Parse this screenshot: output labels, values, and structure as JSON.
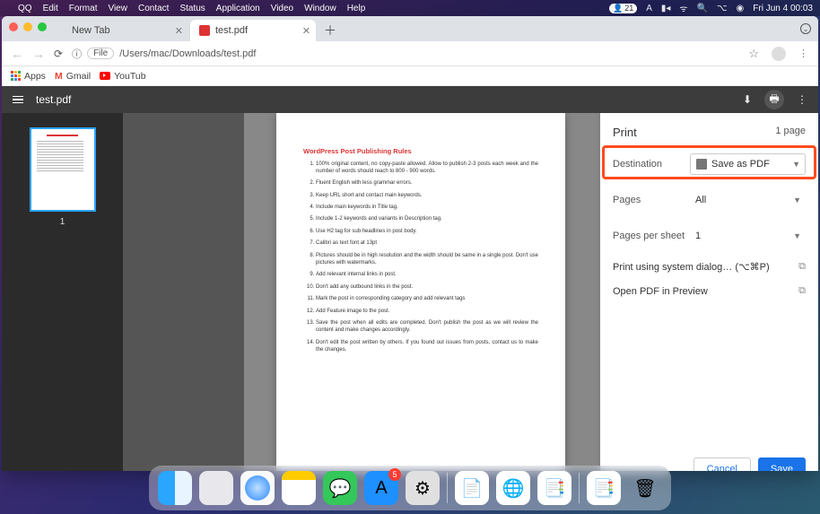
{
  "menubar": {
    "app": "QQ",
    "items": [
      "Edit",
      "Format",
      "View",
      "Contact",
      "Status",
      "Application",
      "Video",
      "Window",
      "Help"
    ],
    "right": {
      "badge": "21",
      "clock": "Fri Jun 4  00:03"
    }
  },
  "chrome": {
    "tabs": [
      {
        "title": "New Tab",
        "active": false
      },
      {
        "title": "test.pdf",
        "active": true
      }
    ],
    "omnibox": {
      "file_chip": "File",
      "url": "/Users/mac/Downloads/test.pdf"
    },
    "bookmarks": {
      "apps": "Apps",
      "gmail": "Gmail",
      "youtube": "YouTub"
    }
  },
  "pdf_toolbar": {
    "title": "test.pdf"
  },
  "thumb": {
    "page_num": "1"
  },
  "document": {
    "title": "WordPress Post Publishing Rules",
    "items": [
      "100% original content, no copy-paste allowed. Allow to publish 2-3 posts each week and the number of words should reach to 800 - 900 words.",
      "Fluent English with less grammar errors.",
      "Keep URL short and contact main keywords.",
      "Include main keywords in Title tag.",
      "Include 1-2 keywords and variants in Description tag.",
      "Use H2 tag for sub headlines in post body.",
      "Calibri as text font at 13pt",
      "Pictures should be in high resolution and the width should be same in a single post. Don't use pictures with watermarks.",
      "Add relevant internal links in post.",
      "Don't add any outbound links in the post.",
      "Mark the post in corresponding category and add relevant tags",
      "Add Feature image to the post.",
      "Save the post when all edits are completed. Don't publish the post as we will review the content and make changes accordingly.",
      "Don't edit the post written by others. If you found out issues from posts, contact us to make the changes."
    ]
  },
  "under_page": {
    "line1": "post. Don't use pictures with watermarks.",
    "line2": "9.   Add relevant internal links in post."
  },
  "print": {
    "title": "Print",
    "count": "1 page",
    "rows": {
      "destination": {
        "label": "Destination",
        "value": "Save as PDF"
      },
      "pages": {
        "label": "Pages",
        "value": "All"
      },
      "per_sheet": {
        "label": "Pages per sheet",
        "value": "1"
      }
    },
    "links": {
      "system": "Print using system dialog… (⌥⌘P)",
      "preview": "Open PDF in Preview"
    },
    "buttons": {
      "cancel": "Cancel",
      "save": "Save"
    }
  },
  "dock": {
    "appstore_badge": "5"
  }
}
